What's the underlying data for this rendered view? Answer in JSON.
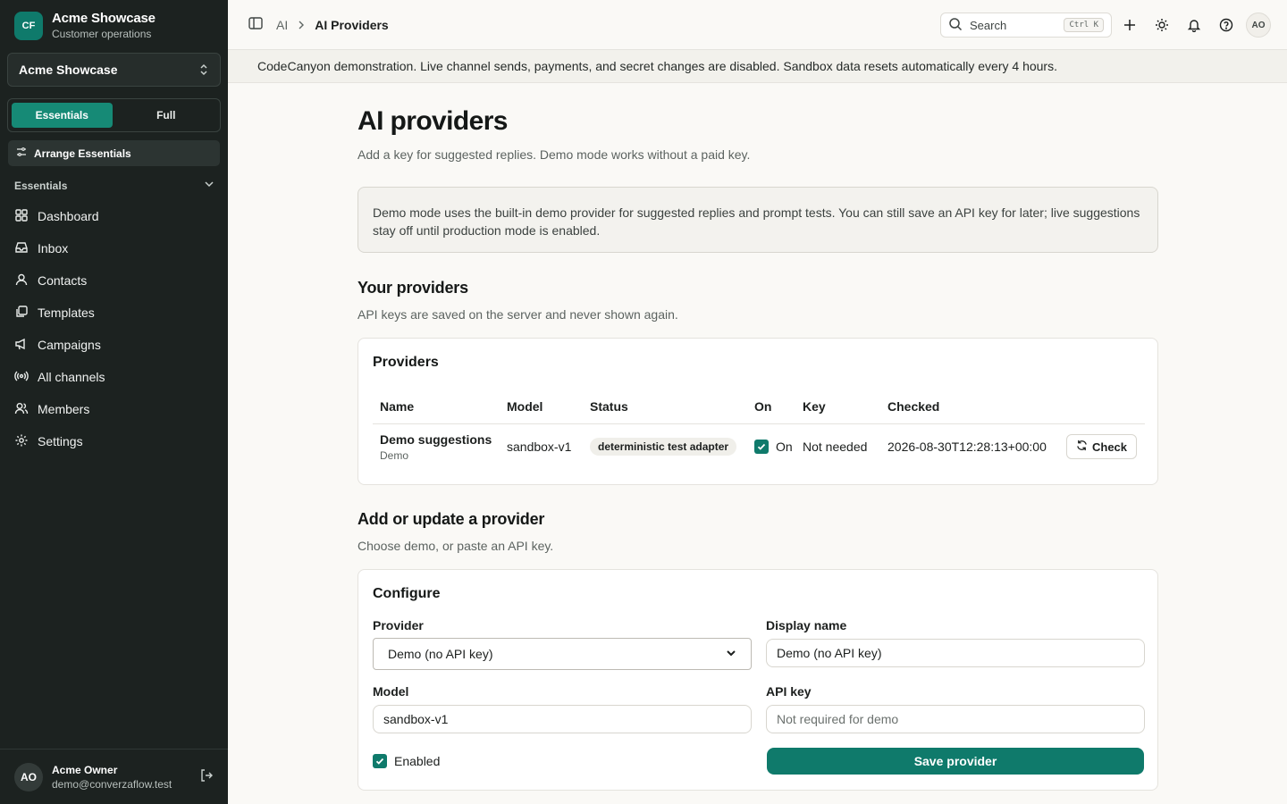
{
  "sidebar": {
    "brand_initials": "CF",
    "brand_name": "Acme Showcase",
    "brand_sub": "Customer operations",
    "workspace": "Acme Showcase",
    "modes": [
      "Essentials",
      "Full"
    ],
    "arrange_label": "Arrange Essentials",
    "section_label": "Essentials",
    "items": [
      {
        "label": "Dashboard",
        "icon": "dashboard-icon"
      },
      {
        "label": "Inbox",
        "icon": "inbox-icon"
      },
      {
        "label": "Contacts",
        "icon": "contacts-icon"
      },
      {
        "label": "Templates",
        "icon": "templates-icon"
      },
      {
        "label": "Campaigns",
        "icon": "megaphone-icon"
      },
      {
        "label": "All channels",
        "icon": "broadcast-icon"
      },
      {
        "label": "Members",
        "icon": "members-icon"
      },
      {
        "label": "Settings",
        "icon": "gear-icon"
      }
    ],
    "user": {
      "initials": "AO",
      "name": "Acme Owner",
      "email": "demo@converzaflow.test"
    }
  },
  "topbar": {
    "breadcrumb": [
      "AI",
      "AI Providers"
    ],
    "search_placeholder": "Search",
    "search_shortcut": "Ctrl K",
    "avatar_initials": "AO"
  },
  "banner": "CodeCanyon demonstration. Live channel sends, payments, and secret changes are disabled. Sandbox data resets automatically every 4 hours.",
  "page": {
    "title": "AI providers",
    "subtitle": "Add a key for suggested replies. Demo mode works without a paid key.",
    "notice": "Demo mode uses the built-in demo provider for suggested replies and prompt tests. You can still save an API key for later; live suggestions stay off until production mode is enabled."
  },
  "providers_section": {
    "title": "Your providers",
    "subtitle": "API keys are saved on the server and never shown again.",
    "card_title": "Providers",
    "columns": [
      "Name",
      "Model",
      "Status",
      "On",
      "Key",
      "Checked"
    ],
    "rows": [
      {
        "name": "Demo suggestions",
        "type": "Demo",
        "model": "sandbox-v1",
        "status": "deterministic test adapter",
        "on_label": "On",
        "key": "Not needed",
        "checked": "2026-08-30T12:28:13+00:00",
        "action": "Check"
      }
    ]
  },
  "form_section": {
    "title": "Add or update a provider",
    "subtitle": "Choose demo, or paste an API key.",
    "card_title": "Configure",
    "provider_label": "Provider",
    "provider_value": "Demo (no API key)",
    "display_name_label": "Display name",
    "display_name_value": "Demo (no API key)",
    "model_label": "Model",
    "model_value": "sandbox-v1",
    "api_key_label": "API key",
    "api_key_placeholder": "Not required for demo",
    "enabled_label": "Enabled",
    "save_label": "Save provider"
  },
  "colors": {
    "accent": "#0f7a6b",
    "sidebar_bg": "#1c2220"
  }
}
